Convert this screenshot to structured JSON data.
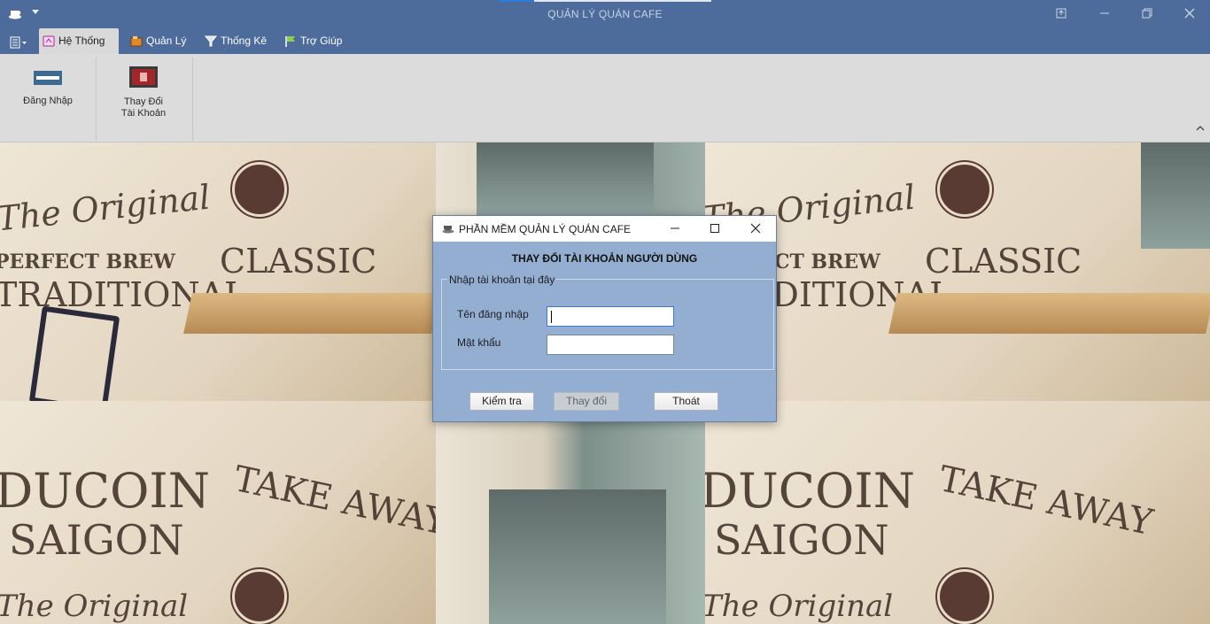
{
  "window": {
    "title": "QUẢN LÝ QUÁN CAFE",
    "controls": [
      "restore-down",
      "minimize",
      "maximize",
      "close"
    ]
  },
  "ribbon_tabs": [
    {
      "label": "Hệ Thống",
      "active": true,
      "icon": "system-icon"
    },
    {
      "label": "Quản Lý",
      "active": false,
      "icon": "manage-icon"
    },
    {
      "label": "Thống Kê",
      "active": false,
      "icon": "statistics-icon"
    },
    {
      "label": "Trợ Giúp",
      "active": false,
      "icon": "help-flag-icon"
    }
  ],
  "ribbon_buttons": [
    {
      "label": "Đăng Nhập",
      "icon": "login-icon"
    },
    {
      "label_line1": "Thay Đổi",
      "label_line2": "Tài Khoản",
      "icon": "change-account-icon"
    }
  ],
  "background": {
    "wall_texts": [
      "The Original",
      "PERFECT BREW",
      "TRADITIONAL",
      "CLASSIC",
      "TAKE AWAY",
      "DUCOIN",
      "SAIGON"
    ]
  },
  "dialog": {
    "title": "PHẦN MỀM QUẢN LÝ QUÁN CAFE",
    "heading": "THAY ĐỔI TÀI KHOẢN NGƯỜI DÙNG",
    "group_label": "Nhập tài khoản tại đây",
    "username_label": "Tên đăng nhập",
    "username_value": "",
    "password_label": "Mật khẩu",
    "password_value": "",
    "buttons": {
      "check": "Kiểm tra",
      "change": "Thay đổi",
      "exit": "Thoát"
    },
    "change_enabled": false
  },
  "colors": {
    "titlebar": "#4d6c9b",
    "ribbon": "#dcdcdc",
    "dialog_bg": "#94aed2"
  }
}
